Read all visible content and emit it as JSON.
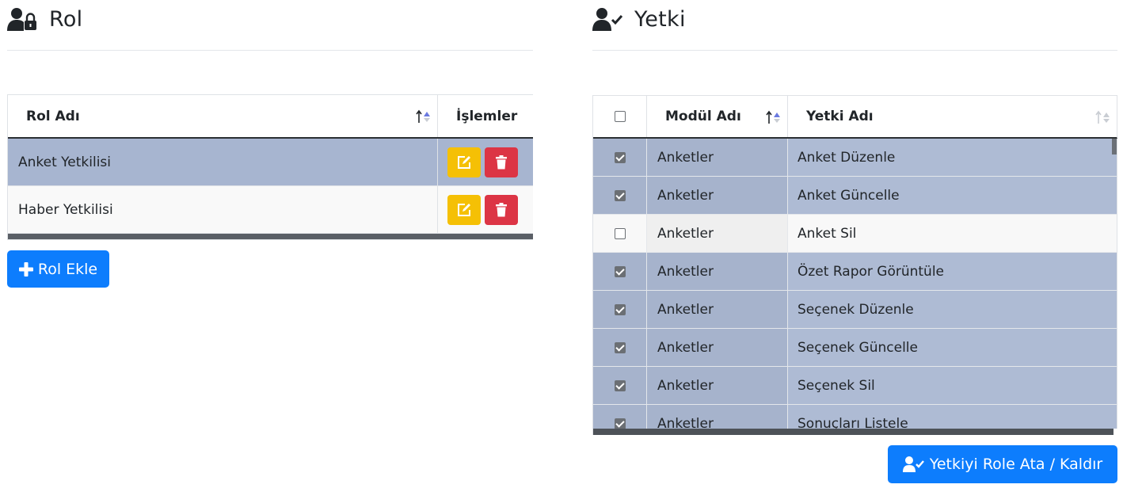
{
  "rol": {
    "title": "Rol",
    "icon": "user-lock-icon",
    "columns": {
      "name": "Rol Adı",
      "operations": "İşlemler"
    },
    "rows": [
      {
        "name": "Anket Yetkilisi",
        "selected": true
      },
      {
        "name": "Haber Yetkilisi",
        "selected": false
      }
    ],
    "add_button": "Rol Ekle"
  },
  "yetki": {
    "title": "Yetki",
    "icon": "user-check-icon",
    "columns": {
      "module": "Modül Adı",
      "permission": "Yetki Adı"
    },
    "rows": [
      {
        "module": "Anketler",
        "permission": "Anket Düzenle",
        "checked": true
      },
      {
        "module": "Anketler",
        "permission": "Anket Güncelle",
        "checked": true
      },
      {
        "module": "Anketler",
        "permission": "Anket Sil",
        "checked": false
      },
      {
        "module": "Anketler",
        "permission": "Özet Rapor Görüntüle",
        "checked": true
      },
      {
        "module": "Anketler",
        "permission": "Seçenek Düzenle",
        "checked": true
      },
      {
        "module": "Anketler",
        "permission": "Seçenek Güncelle",
        "checked": true
      },
      {
        "module": "Anketler",
        "permission": "Seçenek Sil",
        "checked": true
      },
      {
        "module": "Anketler",
        "permission": "Sonuçları Listele",
        "checked": true
      }
    ],
    "assign_button": "Yetkiyi Role Ata / Kaldır"
  },
  "colors": {
    "primary": "#0d7dfd",
    "edit": "#f5c005",
    "delete": "#dc3545",
    "selected_row": "#a7b5d0"
  }
}
